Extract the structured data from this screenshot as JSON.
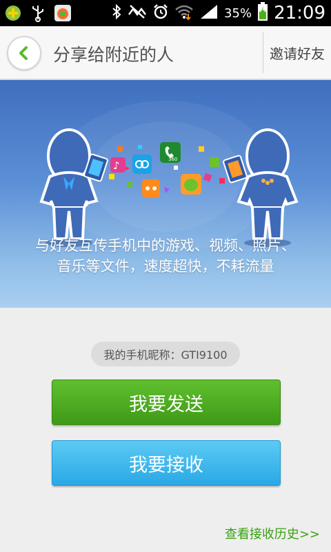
{
  "status_bar": {
    "battery_percent": "35%",
    "time": "21:09",
    "icons": [
      "addon-icon",
      "usb-icon",
      "app-notification-icon",
      "bluetooth-icon",
      "mute-icon",
      "alarm-icon",
      "wifi-icon",
      "signal-icon",
      "battery-icon"
    ]
  },
  "header": {
    "title": "分享给附近的人",
    "invite_label": "邀请好友",
    "back_icon": "back-arrow-icon"
  },
  "hero": {
    "line1": "与好友互传手机中的游戏、视频、照片、",
    "line2": "音乐等文件，速度超快，不耗流量",
    "app_badge": "360"
  },
  "nickname": {
    "label": "我的手机昵称：GTI9100"
  },
  "actions": {
    "send_label": "我要发送",
    "receive_label": "我要接收"
  },
  "history": {
    "label": "查看接收历史>>"
  },
  "colors": {
    "send_green": "#4fae22",
    "receive_blue": "#3bb5ec",
    "history_green": "#3aa010",
    "hero_top": "#3f6fbf"
  }
}
